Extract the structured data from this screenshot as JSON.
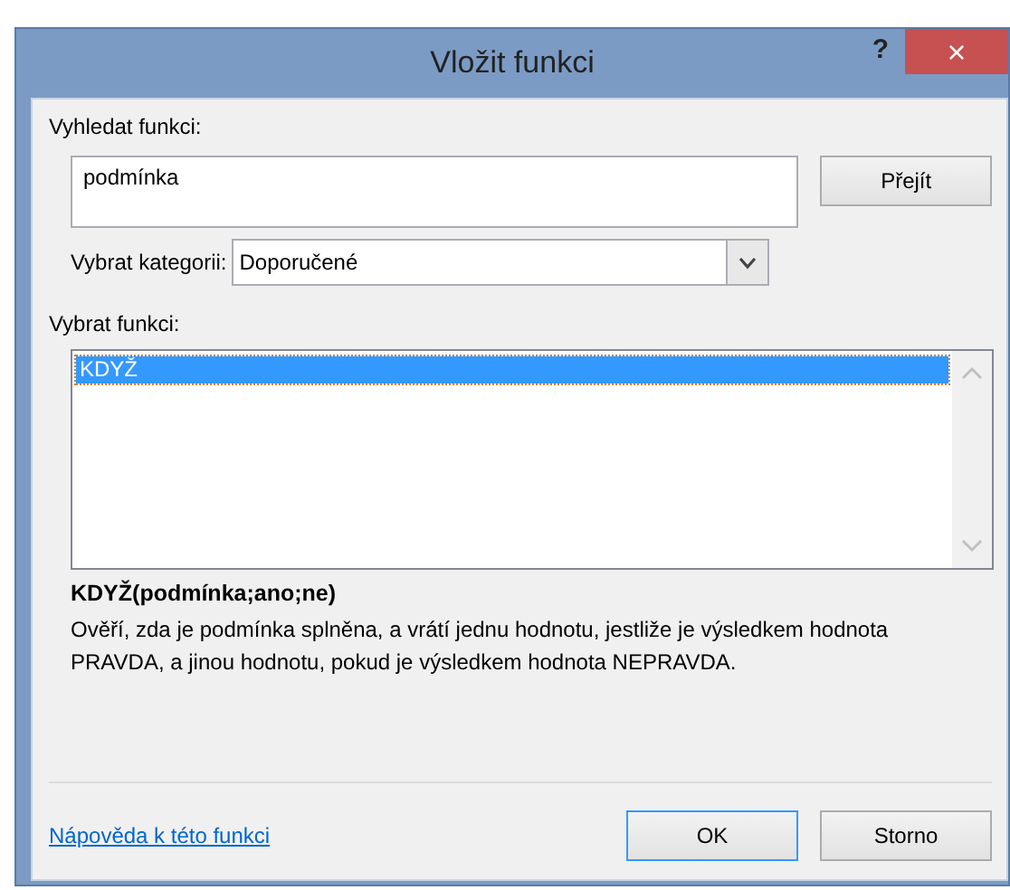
{
  "window": {
    "title": "Vložit funkci",
    "help": "?",
    "close": "×"
  },
  "search": {
    "label": "Vyhledat funkci:",
    "value": "podmínka",
    "button": "Přejít"
  },
  "category": {
    "label": "Vybrat kategorii:",
    "value": "Doporučené"
  },
  "functions": {
    "label": "Vybrat funkci:",
    "items": [
      {
        "label": "KDYŽ",
        "selected": true
      }
    ]
  },
  "signature": "KDYŽ(podmínka;ano;ne)",
  "description": "Ověří, zda je podmínka splněna, a vrátí jednu hodnotu, jestliže je výsledkem hodnota PRAVDA, a jinou hodnotu, pokud je výsledkem hodnota NEPRAVDA.",
  "help_link": "Nápověda k této funkci",
  "buttons": [
    {
      "label": "OK",
      "default": true
    },
    {
      "label": "Storno",
      "default": false
    }
  ]
}
